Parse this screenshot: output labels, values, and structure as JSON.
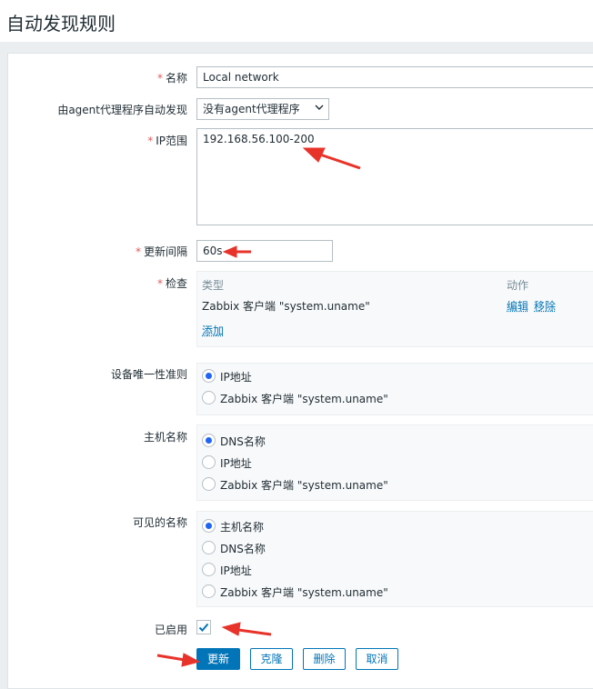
{
  "page": {
    "title": "自动发现规则"
  },
  "form": {
    "name": {
      "label": "名称",
      "required": "*",
      "value": "Local network"
    },
    "proxy": {
      "label": "由agent代理程序自动发现",
      "value": "没有agent代理程序"
    },
    "ip_range": {
      "label": "IP范围",
      "required": "*",
      "value": "192.168.56.100-200"
    },
    "interval": {
      "label": "更新间隔",
      "required": "*",
      "value": "60s"
    },
    "checks": {
      "label": "检查",
      "required": "*",
      "col_type": "类型",
      "col_action": "动作",
      "rows": [
        {
          "type": "Zabbix 客户端 \"system.uname\"",
          "edit": "编辑",
          "remove": "移除"
        }
      ],
      "add": "添加"
    },
    "uniqueness": {
      "label": "设备唯一性准则",
      "options": [
        "IP地址",
        "Zabbix 客户端 \"system.uname\""
      ],
      "selected": 0
    },
    "host_name": {
      "label": "主机名称",
      "options": [
        "DNS名称",
        "IP地址",
        "Zabbix 客户端 \"system.uname\""
      ],
      "selected": 0
    },
    "visible_name": {
      "label": "可见的名称",
      "options": [
        "主机名称",
        "DNS名称",
        "IP地址",
        "Zabbix 客户端 \"system.uname\""
      ],
      "selected": 0
    },
    "enabled": {
      "label": "已启用",
      "checked": true
    }
  },
  "buttons": {
    "update": "更新",
    "clone": "克隆",
    "delete": "删除",
    "cancel": "取消"
  },
  "colors": {
    "accent": "#0275b8",
    "annotation_arrow": "#e8332a",
    "required": "#e45959"
  }
}
